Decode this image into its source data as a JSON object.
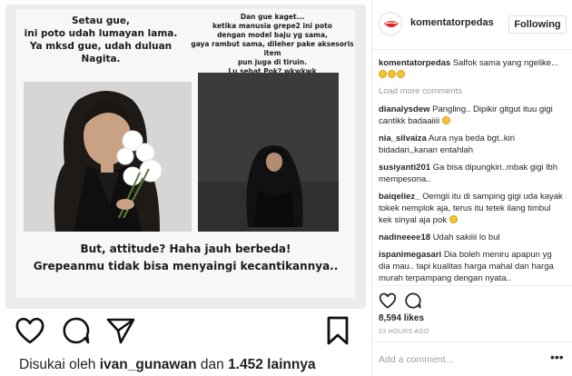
{
  "post": {
    "caption_left": [
      "Setau gue,",
      "ini poto udah lumayan lama.",
      "Ya mksd gue, udah duluan Nagita."
    ],
    "caption_right": [
      "Dan gue kaget...",
      "ketika manusia grepe2 ini poto",
      "dengan model baju yg sama,",
      "gaya rambut sama, dileher pake aksesoris item",
      "pun juga di tiruin.",
      "Lu sehat Pok? wkwkwk"
    ],
    "caption_bottom": [
      "But, attitude? Haha jauh berbeda!",
      "Grepeanmu tidak bisa menyaingi kecantikannya.."
    ],
    "liked_by_prefix": "Disukai oleh",
    "liked_by_user": "ivan_gunawan",
    "liked_by_and": "dan",
    "liked_by_count": "1.452 lainnya"
  },
  "panel": {
    "username": "komentatorpedas",
    "follow_label": "Following",
    "load_more": "Load more comments",
    "comments": [
      {
        "user": "komentatorpedas",
        "text": "Salfok sama yang ngelike..."
      },
      {
        "user": "dianalysdew",
        "text": "Pangling.. Dipikir gitgut ituu gigi cantikk badaaiiii"
      },
      {
        "user": "nia_silvaiza",
        "text": "Aura nya beda bgt..kiri bidadari,,kanan entahlah"
      },
      {
        "user": "susiyanti201",
        "text": "Ga bisa dipungkiri..mbak gigi lbh mempesona.."
      },
      {
        "user": "baiqeliez_",
        "text": "Oemgii itu di samping gigi uda kayak tokek nemplok aja, terus itu tetek ilang timbul kek sinyal aja pok"
      },
      {
        "user": "nadineeee18",
        "text": "Udah sakiiii lo bul"
      },
      {
        "user": "ispanimegasari",
        "text": "Dia boleh meniru apapun yg dia mau.. tapi kualitas harga mahal dan harga murah terpampang dengan nyata.. eeeiiimmmm..."
      }
    ],
    "likes": "8,594 likes",
    "time": "23 HOURS AGO",
    "add_comment_placeholder": "Add a comment...",
    "more_dots": "•••"
  }
}
